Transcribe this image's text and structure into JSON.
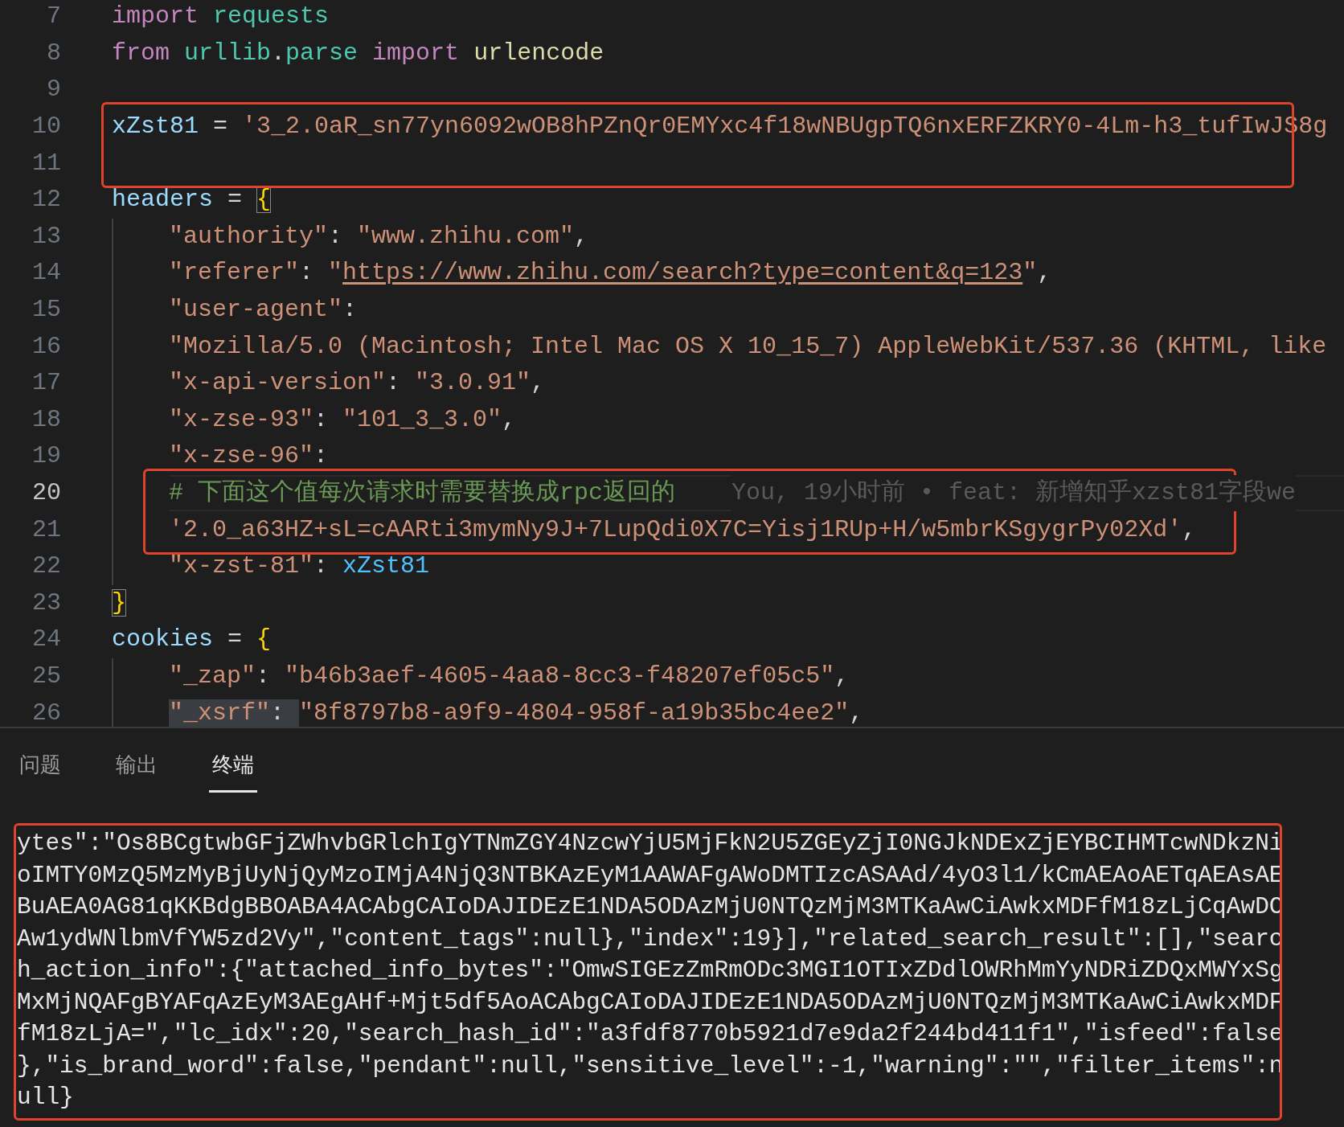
{
  "editor": {
    "lines": [
      {
        "number": "7",
        "current": false,
        "boxed": false,
        "tokens": [
          {
            "text": "import ",
            "kind": "keyword"
          },
          {
            "text": "requests",
            "kind": "module"
          }
        ]
      },
      {
        "number": "8",
        "current": false,
        "boxed": false,
        "tokens": [
          {
            "text": "from ",
            "kind": "keyword"
          },
          {
            "text": "urllib",
            "kind": "module"
          },
          {
            "text": ".",
            "kind": "plain"
          },
          {
            "text": "parse ",
            "kind": "module"
          },
          {
            "text": "import ",
            "kind": "keyword"
          },
          {
            "text": "urlencode",
            "kind": "function"
          }
        ]
      },
      {
        "number": "9",
        "current": false,
        "boxed": false
      },
      {
        "number": "10",
        "current": false,
        "boxed": true,
        "tokens": [
          {
            "text": "xZst81",
            "kind": "variable"
          },
          {
            "text": " = ",
            "kind": "plain"
          },
          {
            "text": "'3_2.0aR_sn77yn6092wOB8hPZnQr0EMYxc4f18wNBUgpTQ6nxERFZKRY0-4Lm-h3_tufIwJS8g",
            "kind": "string"
          }
        ]
      },
      {
        "number": "11",
        "current": false,
        "boxed": true
      },
      {
        "number": "12",
        "current": false,
        "boxed": false,
        "tokens": [
          {
            "text": "headers",
            "kind": "variable"
          },
          {
            "text": " = ",
            "kind": "plain"
          },
          {
            "text": "{",
            "kind": "bracket",
            "matched": true
          }
        ],
        "children": [
          {
            "number": "13",
            "current": false,
            "boxed": false,
            "tokens": [
              {
                "text": "\"authority\"",
                "kind": "string"
              },
              {
                "text": ": ",
                "kind": "plain"
              },
              {
                "text": "\"www.zhihu.com\"",
                "kind": "string"
              },
              {
                "text": ",",
                "kind": "plain"
              }
            ]
          },
          {
            "number": "14",
            "current": false,
            "boxed": false,
            "tokens": [
              {
                "text": "\"referer\"",
                "kind": "string"
              },
              {
                "text": ": ",
                "kind": "plain"
              },
              {
                "text": "\"",
                "kind": "string"
              },
              {
                "text": "https://www.zhihu.com/search?type=content&q=123",
                "kind": "link"
              },
              {
                "text": "\"",
                "kind": "string"
              },
              {
                "text": ",",
                "kind": "plain"
              }
            ]
          },
          {
            "number": "15",
            "current": false,
            "boxed": false,
            "tokens": [
              {
                "text": "\"user-agent\"",
                "kind": "string"
              },
              {
                "text": ":",
                "kind": "plain"
              }
            ]
          },
          {
            "number": "16",
            "current": false,
            "boxed": false,
            "tokens": [
              {
                "text": "\"Mozilla/5.0 (Macintosh; Intel Mac OS X 10_15_7) AppleWebKit/537.36 (KHTML, like",
                "kind": "string"
              }
            ]
          },
          {
            "number": "17",
            "current": false,
            "boxed": false,
            "tokens": [
              {
                "text": "\"x-api-version\"",
                "kind": "string"
              },
              {
                "text": ": ",
                "kind": "plain"
              },
              {
                "text": "\"3.0.91\"",
                "kind": "string"
              },
              {
                "text": ",",
                "kind": "plain"
              }
            ]
          },
          {
            "number": "18",
            "current": false,
            "boxed": false,
            "tokens": [
              {
                "text": "\"x-zse-93\"",
                "kind": "string"
              },
              {
                "text": ": ",
                "kind": "plain"
              },
              {
                "text": "\"101_3_3.0\"",
                "kind": "string"
              },
              {
                "text": ",",
                "kind": "plain"
              }
            ]
          },
          {
            "number": "19",
            "current": false,
            "boxed": false,
            "tokens": [
              {
                "text": "\"x-zse-96\"",
                "kind": "string"
              },
              {
                "text": ":",
                "kind": "plain"
              }
            ]
          },
          {
            "number": "20",
            "current": true,
            "boxed": true,
            "tokens": [
              {
                "text": "# 下面这个值每次请求时需要替换成rpc返回的",
                "kind": "comment"
              }
            ],
            "blame": "You, 19小时前 • feat: 新增知乎xzst81字段we"
          },
          {
            "number": "21",
            "current": false,
            "boxed": true,
            "tokens": [
              {
                "text": "'2.0_a63HZ+sL=cAARti3mymNy9J+7LupQdi0X7C=Yisj1RUp+H/w5mbrKSgygrPy02Xd'",
                "kind": "string"
              },
              {
                "text": ",",
                "kind": "plain"
              }
            ]
          },
          {
            "number": "22",
            "current": false,
            "boxed": false,
            "tokens": [
              {
                "text": "\"x-zst-81\"",
                "kind": "string"
              },
              {
                "text": ": ",
                "kind": "plain"
              },
              {
                "text": "xZst81",
                "kind": "constant"
              }
            ]
          }
        ]
      },
      {
        "number": "23",
        "current": false,
        "boxed": false,
        "tokens": [
          {
            "text": "}",
            "kind": "bracket",
            "matched": true
          }
        ]
      },
      {
        "number": "24",
        "current": false,
        "boxed": false,
        "tokens": [
          {
            "text": "cookies",
            "kind": "variable"
          },
          {
            "text": " = ",
            "kind": "plain"
          },
          {
            "text": "{",
            "kind": "bracket",
            "matched": false
          }
        ],
        "children": [
          {
            "number": "25",
            "current": false,
            "boxed": false,
            "tokens": [
              {
                "text": "\"_zap\"",
                "kind": "string"
              },
              {
                "text": ": ",
                "kind": "plain"
              },
              {
                "text": "\"b46b3aef-4605-4aa8-8cc3-f48207ef05c5\"",
                "kind": "string"
              },
              {
                "text": ",",
                "kind": "plain"
              }
            ]
          },
          {
            "number": "26",
            "current": false,
            "boxed": false,
            "tokens": [
              {
                "text": "\"_xsrf\"",
                "kind": "string",
                "selected": true
              },
              {
                "text": ": ",
                "kind": "plain",
                "selected": true
              },
              {
                "text": "\"8f8797b8-a9f9-4804-958f-a19b35bc4ee2\"",
                "kind": "string",
                "selected": false
              },
              {
                "text": ",",
                "kind": "plain",
                "selected": false
              }
            ]
          }
        ]
      }
    ]
  },
  "panel": {
    "tabs": [
      {
        "label": "问题",
        "selected": false
      },
      {
        "label": "输出",
        "selected": false
      },
      {
        "label": "终端",
        "selected": true
      }
    ],
    "terminal": {
      "boxed": true,
      "lines": [
        "ytes\":\"Os8BCgtwbGFjZWhvbGRlchIgYTNmZGY4NzcwYjU5MjFkN2U5ZGEyZjI0NGJkNDExZjEYBCIHMTcwNDkzNi",
        "oIMTY0MzQ5MzMyBjUyNjQyMzoIMjA4NjQ3NTBKAzEyM1AAWAFgAWoDMTIzcASAAd/4yO3l1/kCmAEAoAETqAEAsAE",
        "BuAEA0AG81qKKBdgBBOABA4ACAbgCAIoDAJIDEzE1NDA5ODAzMjU0NTQzMjM3MTKaAwCiAwkxMDFfM18zLjCqAwDC",
        "Aw1ydWNlbmVfYW5zd2Vy\",\"content_tags\":null},\"index\":19}],\"related_search_result\":[],\"searc",
        "h_action_info\":{\"attached_info_bytes\":\"OmwSIGEzZmRmODc3MGI1OTIxZDdlOWRhMmYyNDRiZDQxMWYxSg",
        "MxMjNQAFgBYAFqAzEyM3AEgAHf+Mjt5df5AoACAbgCAIoDAJIDEzE1NDA5ODAzMjU0NTQzMjM3MTKaAwCiAwkxMDF",
        "fM18zLjA=\",\"lc_idx\":20,\"search_hash_id\":\"a3fdf8770b5921d7e9da2f244bd411f1\",\"isfeed\":false",
        "},\"is_brand_word\":false,\"pendant\":null,\"sensitive_level\":-1,\"warning\":\"\",\"filter_items\":n",
        "ull}"
      ]
    }
  }
}
